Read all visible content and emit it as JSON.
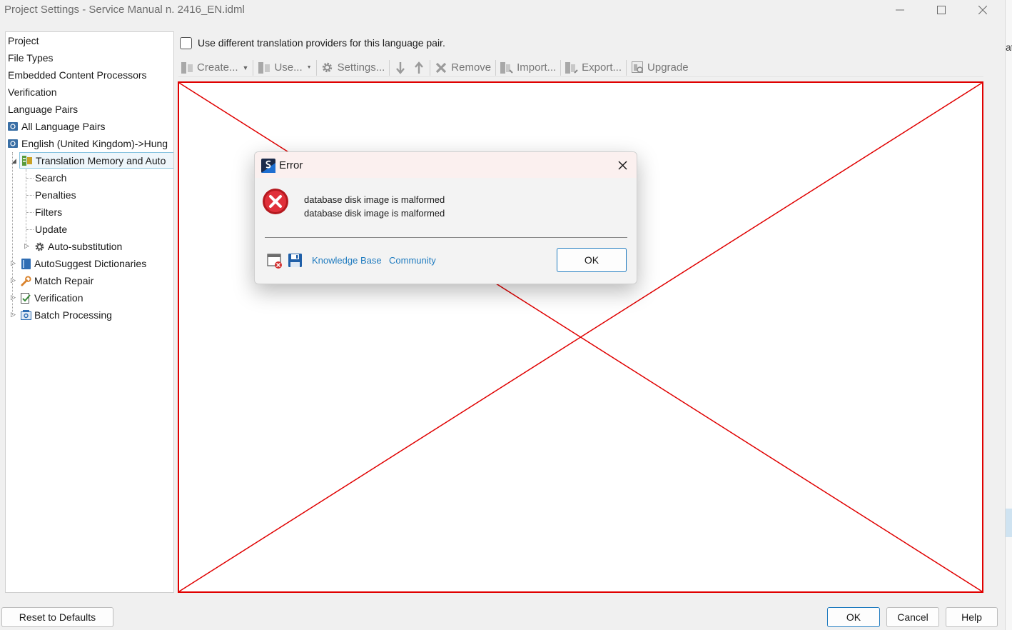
{
  "window": {
    "title": "Project Settings - Service Manual n. 2416_EN.idml",
    "controls": [
      "minimize-icon",
      "maximize-icon",
      "close-icon"
    ]
  },
  "tree": {
    "items": [
      {
        "label": "Project"
      },
      {
        "label": "File Types"
      },
      {
        "label": "Embedded Content Processors"
      },
      {
        "label": "Verification"
      },
      {
        "label": "Language Pairs"
      },
      {
        "label": "All Language Pairs",
        "icon": "language-pair-icon"
      },
      {
        "label": "English (United Kingdom)->Hung",
        "icon": "language-pair-icon"
      },
      {
        "label": "Translation Memory and Auto",
        "icon": "translation-memory-icon",
        "selected": true
      },
      {
        "label": "Search"
      },
      {
        "label": "Penalties"
      },
      {
        "label": "Filters"
      },
      {
        "label": "Update"
      },
      {
        "label": "Auto-substitution",
        "icon": "gear-icon"
      },
      {
        "label": "AutoSuggest Dictionaries",
        "icon": "dictionary-icon"
      },
      {
        "label": "Match Repair",
        "icon": "wrench-icon"
      },
      {
        "label": "Verification",
        "icon": "verification-icon"
      },
      {
        "label": "Batch Processing",
        "icon": "batch-icon"
      }
    ]
  },
  "main": {
    "checkbox_label": "Use different translation providers for this language pair.",
    "checkbox_checked": false,
    "toolbar": {
      "create": "Create...",
      "use": "Use...",
      "settings": "Settings...",
      "remove": "Remove",
      "import": "Import...",
      "export": "Export...",
      "upgrade": "Upgrade"
    }
  },
  "dialog": {
    "title": "Error",
    "message_line1": "database disk image is malformed",
    "message_line2": "database disk image is malformed",
    "link_kb": "Knowledge Base",
    "link_community": "Community",
    "ok": "OK"
  },
  "footer": {
    "reset": "Reset to Defaults",
    "ok": "OK",
    "cancel": "Cancel",
    "help": "Help"
  },
  "colors": {
    "accent": "#1f7bbf",
    "error_red": "#e00000",
    "selection_bg": "#eef6fb"
  },
  "background_window": {
    "text_fragment": "at"
  }
}
